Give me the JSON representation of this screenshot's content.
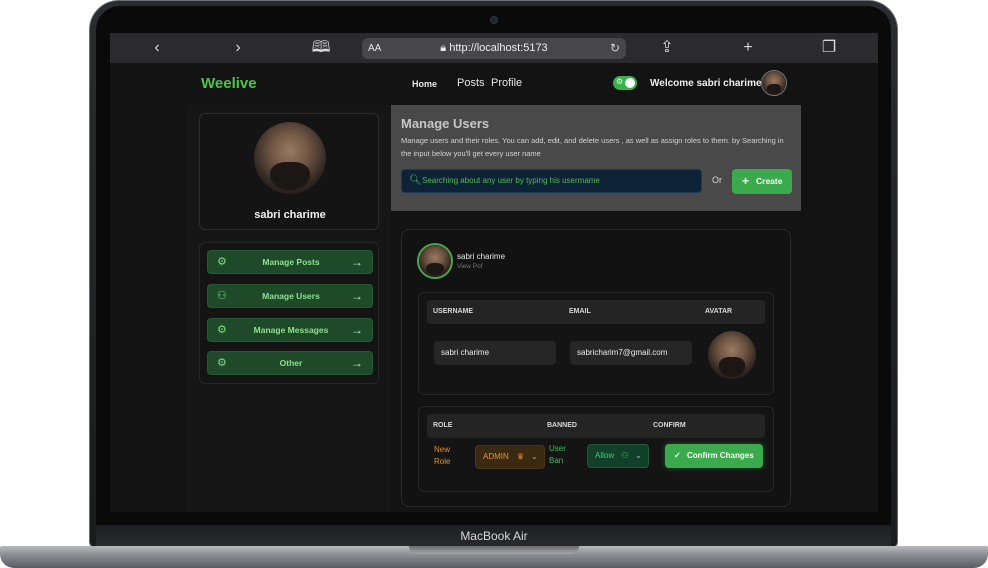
{
  "device": {
    "model_label": "MacBook Air"
  },
  "browser": {
    "back_icon": "chevron-left-icon",
    "forward_icon": "chevron-right-icon",
    "text_size_label": "AA",
    "url": "http://localhost:5173",
    "lock_icon": "lock-icon",
    "reload_icon": "reload-icon"
  },
  "navbar": {
    "brand": "Weelive",
    "links": [
      "Home",
      "Posts",
      "Profile"
    ],
    "welcome": "Welcome sabri charime"
  },
  "sidebar": {
    "profile_name": "sabri charime",
    "items": [
      {
        "label": "Manage Posts",
        "icon": "gear-icon"
      },
      {
        "label": "Manage Users",
        "icon": "users-icon"
      },
      {
        "label": "Manage Messages",
        "icon": "gear-icon"
      },
      {
        "label": "Other",
        "icon": "gear-icon"
      }
    ]
  },
  "manage": {
    "title": "Manage Users",
    "description": "Manage users and their roles. You can add, edit, and delete users , as well as assign roles to them. by Searching in the input below you'll get every user name",
    "search_placeholder": "Searching about any user by typing  his usermame",
    "or": "Or",
    "create_label": "Create"
  },
  "user_card": {
    "name": "sabri charime",
    "view_label": "View Pof",
    "table1": {
      "headers": [
        "USERNAME",
        "EMAIL",
        "AVATAR"
      ],
      "username": "sabri charime",
      "email": "sabricharim7@gmail.com"
    },
    "table2": {
      "headers": [
        "ROLE",
        "BANNED",
        "CONFIRM"
      ],
      "role_label_1": "New",
      "role_label_2": "Role",
      "role_value": "ADMIN",
      "ban_label_1": "User",
      "ban_label_2": "Ban",
      "ban_value": "Allow",
      "confirm_label": "Confirm Changes"
    }
  }
}
